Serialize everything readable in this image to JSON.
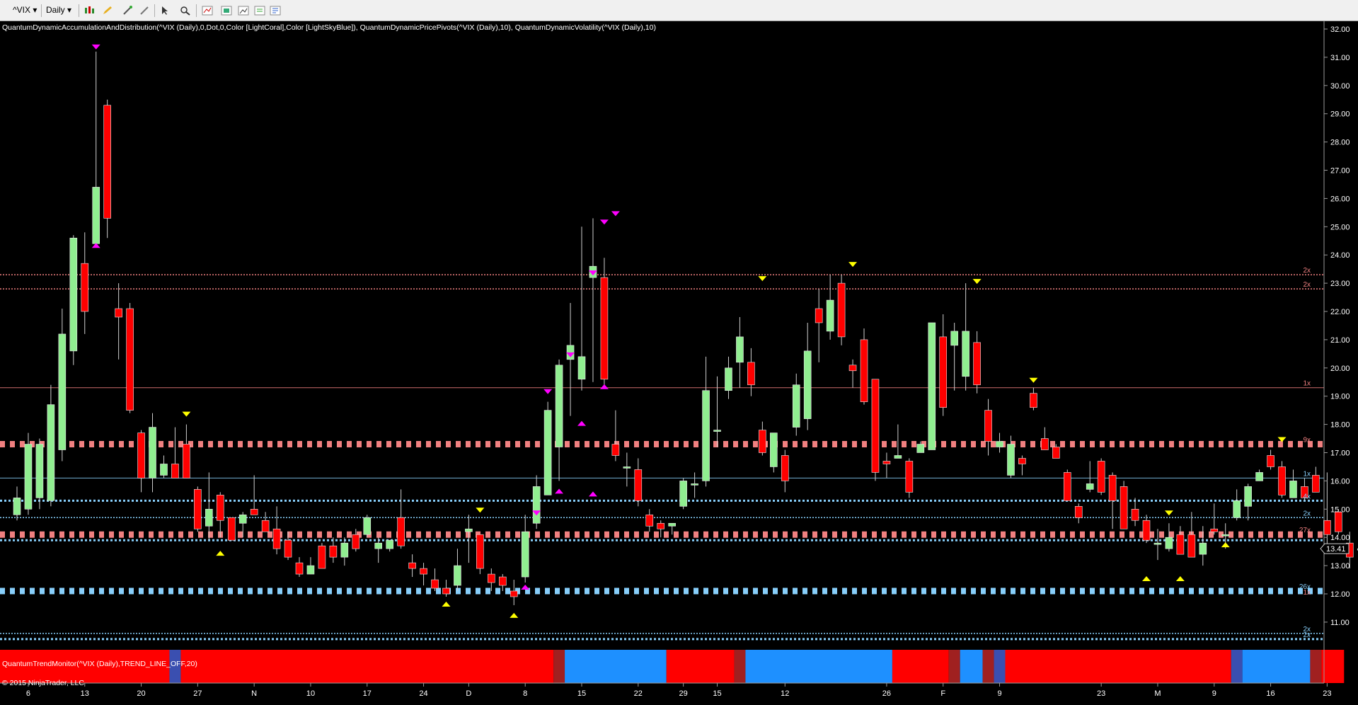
{
  "toolbar": {
    "symbol": "^VIX",
    "interval": "Daily"
  },
  "indicator_label": "QuantumDynamicAccumulationAndDistribution(^VIX (Daily),0,Dot,0,Color [LightCoral],Color [LightSkyBlue]), QuantumDynamicPricePivots(^VIX (Daily),10), QuantumDynamicVolatility(^VIX (Daily),10)",
  "trend_label": "QuantumTrendMonitor(^VIX (Daily),TREND_LINE_OFF,20)",
  "copyright": "© 2015 NinjaTrader, LLC",
  "last_price_label": "13.41",
  "colors": {
    "bull": "#90ee90",
    "bear": "#ff0000",
    "resistance": "#f08080",
    "support": "#87cefa",
    "pivot_high": "#ff00ff",
    "volatility": "#ffff00",
    "trend_bear": "#ff0000",
    "trend_bull": "#1e90ff"
  },
  "chart_data": {
    "type": "candlestick",
    "symbol": "^VIX",
    "interval": "Daily",
    "ylim": [
      10.3,
      32.3
    ],
    "y_ticks": [
      "11.00",
      "12.00",
      "13.00",
      "14.00",
      "15.00",
      "16.00",
      "17.00",
      "18.00",
      "19.00",
      "20.00",
      "21.00",
      "22.00",
      "23.00",
      "24.00",
      "25.00",
      "26.00",
      "27.00",
      "28.00",
      "29.00",
      "30.00",
      "31.00",
      "32.00"
    ],
    "x_ticks": [
      {
        "label": "6",
        "bar": 1
      },
      {
        "label": "13",
        "bar": 6
      },
      {
        "label": "20",
        "bar": 11
      },
      {
        "label": "27",
        "bar": 16
      },
      {
        "label": "N",
        "bar": 21
      },
      {
        "label": "10",
        "bar": 26
      },
      {
        "label": "17",
        "bar": 31
      },
      {
        "label": "24",
        "bar": 36
      },
      {
        "label": "D",
        "bar": 40
      },
      {
        "label": "8",
        "bar": 45
      },
      {
        "label": "15",
        "bar": 50
      },
      {
        "label": "22",
        "bar": 55
      },
      {
        "label": "29",
        "bar": 59
      },
      {
        "label": "15",
        "bar": 62
      },
      {
        "label": "12",
        "bar": 68
      },
      {
        "label": "26",
        "bar": 77
      },
      {
        "label": "F",
        "bar": 82
      },
      {
        "label": "9",
        "bar": 87
      },
      {
        "label": "23",
        "bar": 96
      },
      {
        "label": "M",
        "bar": 101
      },
      {
        "label": "9",
        "bar": 106
      },
      {
        "label": "16",
        "bar": 111
      },
      {
        "label": "23",
        "bar": 116
      }
    ],
    "candles": [
      [
        14.8,
        15.8,
        14.6,
        15.4
      ],
      [
        15.0,
        17.7,
        14.8,
        17.3
      ],
      [
        15.4,
        17.5,
        15.0,
        17.3
      ],
      [
        15.3,
        19.4,
        15.1,
        18.7
      ],
      [
        17.1,
        22.1,
        16.7,
        21.2
      ],
      [
        20.6,
        24.7,
        20.1,
        24.6
      ],
      [
        23.7,
        24.8,
        21.2,
        22.0
      ],
      [
        24.4,
        31.2,
        24.3,
        26.4
      ],
      [
        29.3,
        29.5,
        24.6,
        25.3
      ],
      [
        22.1,
        23.0,
        20.3,
        21.8
      ],
      [
        22.1,
        22.3,
        18.4,
        18.5
      ],
      [
        17.7,
        17.8,
        15.6,
        16.1
      ],
      [
        16.1,
        18.4,
        15.6,
        17.9
      ],
      [
        16.2,
        16.9,
        16.1,
        16.6
      ],
      [
        16.6,
        17.9,
        16.2,
        16.1
      ],
      [
        17.3,
        18.0,
        16.1,
        16.1
      ],
      [
        15.7,
        15.8,
        14.2,
        14.3
      ],
      [
        14.4,
        16.3,
        13.9,
        15.0
      ],
      [
        15.5,
        15.6,
        14.0,
        14.6
      ],
      [
        14.7,
        14.7,
        13.9,
        13.9
      ],
      [
        14.5,
        14.9,
        14.0,
        14.8
      ],
      [
        15.0,
        16.2,
        14.9,
        14.8
      ],
      [
        14.6,
        14.9,
        14.2,
        14.2
      ],
      [
        14.3,
        15.1,
        13.4,
        13.6
      ],
      [
        13.9,
        14.2,
        13.2,
        13.3
      ],
      [
        13.1,
        13.3,
        12.6,
        12.7
      ],
      [
        12.7,
        13.3,
        12.7,
        13.0
      ],
      [
        13.7,
        13.8,
        12.9,
        12.9
      ],
      [
        13.7,
        14.0,
        13.1,
        13.3
      ],
      [
        13.3,
        14.0,
        13.0,
        13.8
      ],
      [
        14.1,
        14.3,
        13.5,
        13.6
      ],
      [
        14.1,
        14.8,
        14.0,
        14.7
      ],
      [
        13.6,
        14.0,
        13.1,
        13.8
      ],
      [
        13.6,
        13.9,
        13.5,
        13.9
      ],
      [
        14.7,
        15.7,
        13.6,
        13.7
      ],
      [
        13.1,
        13.4,
        12.6,
        12.9
      ],
      [
        12.9,
        13.1,
        12.3,
        12.7
      ],
      [
        12.5,
        12.9,
        12.1,
        12.2
      ],
      [
        12.2,
        12.5,
        11.9,
        12.0
      ],
      [
        12.3,
        13.6,
        12.1,
        13.0
      ],
      [
        14.2,
        14.8,
        13.1,
        14.3
      ],
      [
        14.1,
        14.1,
        12.7,
        12.9
      ],
      [
        12.7,
        12.9,
        12.1,
        12.4
      ],
      [
        12.6,
        12.7,
        12.1,
        12.3
      ],
      [
        12.1,
        12.5,
        11.6,
        11.9
      ],
      [
        12.6,
        14.8,
        12.4,
        14.2
      ],
      [
        14.5,
        16.2,
        14.3,
        15.8
      ],
      [
        15.5,
        18.8,
        15.5,
        18.5
      ],
      [
        17.2,
        20.3,
        16.0,
        20.1
      ],
      [
        20.3,
        22.3,
        18.3,
        20.8
      ],
      [
        19.6,
        25.0,
        19.2,
        20.4
      ],
      [
        23.2,
        25.3,
        19.5,
        23.6
      ],
      [
        23.2,
        23.9,
        19.4,
        19.6
      ],
      [
        17.3,
        18.5,
        16.7,
        16.9
      ],
      [
        16.5,
        17.0,
        15.8,
        16.5
      ],
      [
        16.4,
        16.8,
        15.1,
        15.3
      ],
      [
        14.8,
        15.0,
        14.2,
        14.4
      ],
      [
        14.5,
        14.6,
        14.0,
        14.3
      ],
      [
        14.4,
        14.5,
        14.1,
        14.5
      ],
      [
        15.1,
        16.1,
        15.0,
        16.0
      ],
      [
        15.9,
        16.3,
        15.4,
        15.9
      ],
      [
        16.0,
        20.4,
        15.8,
        19.2
      ],
      [
        17.8,
        19.7,
        17.2,
        17.8
      ],
      [
        19.2,
        20.4,
        18.9,
        20.0
      ],
      [
        20.2,
        21.8,
        19.3,
        21.1
      ],
      [
        20.2,
        20.7,
        19.0,
        19.4
      ],
      [
        17.8,
        18.1,
        16.9,
        17.0
      ],
      [
        16.5,
        17.6,
        16.3,
        17.7
      ],
      [
        16.9,
        17.1,
        15.6,
        16.0
      ],
      [
        17.9,
        19.8,
        17.6,
        19.4
      ],
      [
        18.2,
        21.6,
        17.8,
        20.6
      ],
      [
        22.1,
        22.8,
        20.2,
        21.6
      ],
      [
        21.3,
        23.3,
        21.0,
        22.4
      ],
      [
        23.0,
        23.3,
        20.8,
        21.1
      ],
      [
        20.1,
        20.3,
        19.3,
        19.9
      ],
      [
        21.0,
        21.4,
        18.7,
        18.8
      ],
      [
        19.6,
        19.6,
        16.0,
        16.3
      ],
      [
        16.7,
        17.0,
        16.1,
        16.6
      ],
      [
        16.8,
        18.0,
        16.9,
        16.9
      ],
      [
        16.7,
        16.8,
        15.4,
        15.6
      ],
      [
        17.0,
        17.4,
        17.0,
        17.3
      ],
      [
        17.1,
        21.6,
        17.1,
        21.6
      ],
      [
        21.1,
        21.9,
        18.3,
        18.6
      ],
      [
        20.8,
        21.6,
        19.2,
        21.3
      ],
      [
        19.7,
        23.0,
        19.2,
        21.3
      ],
      [
        20.9,
        21.3,
        19.1,
        19.4
      ],
      [
        18.5,
        18.9,
        16.9,
        17.4
      ],
      [
        17.2,
        17.7,
        17.0,
        17.4
      ],
      [
        16.2,
        17.6,
        16.1,
        17.3
      ],
      [
        16.8,
        16.9,
        16.2,
        16.6
      ],
      [
        19.1,
        19.3,
        18.5,
        18.6
      ],
      [
        17.5,
        17.9,
        17.2,
        17.1
      ],
      [
        17.2,
        17.3,
        16.9,
        16.8
      ],
      [
        16.3,
        16.4,
        15.3,
        15.3
      ],
      [
        15.1,
        15.2,
        14.5,
        14.7
      ],
      [
        15.7,
        16.7,
        15.6,
        15.9
      ],
      [
        16.7,
        16.8,
        15.5,
        15.6
      ],
      [
        16.2,
        16.3,
        14.3,
        15.3
      ],
      [
        15.8,
        16.0,
        14.9,
        14.3
      ],
      [
        15.0,
        15.4,
        14.4,
        14.6
      ],
      [
        14.6,
        14.8,
        13.8,
        13.9
      ],
      [
        13.8,
        14.3,
        13.2,
        13.8
      ],
      [
        13.6,
        14.5,
        13.5,
        14.0
      ],
      [
        14.1,
        14.4,
        13.6,
        13.4
      ],
      [
        14.1,
        14.9,
        13.7,
        13.3
      ],
      [
        13.4,
        14.4,
        13.0,
        13.8
      ],
      [
        14.3,
        15.2,
        14.1,
        14.2
      ],
      [
        14.1,
        14.5,
        13.6,
        14.1
      ],
      [
        14.7,
        15.7,
        14.6,
        15.3
      ],
      [
        15.1,
        15.9,
        14.6,
        15.8
      ],
      [
        16.0,
        16.4,
        16.0,
        16.3
      ],
      [
        16.9,
        17.1,
        16.4,
        16.5
      ],
      [
        16.5,
        16.7,
        15.4,
        15.5
      ],
      [
        15.4,
        16.4,
        15.5,
        16.0
      ],
      [
        15.8,
        16.1,
        15.3,
        15.4
      ],
      [
        16.2,
        16.5,
        15.7,
        15.6
      ],
      [
        14.6,
        16.3,
        13.6,
        14.1
      ],
      [
        14.9,
        15.0,
        14.1,
        14.2
      ],
      [
        13.8,
        14.2,
        12.9,
        13.3
      ],
      [
        13.6,
        13.8,
        13.0,
        13.6
      ]
    ],
    "pivots_high": [
      {
        "bar": 7,
        "value": 31.3,
        "type": "major"
      },
      {
        "bar": 15,
        "value": 18.3,
        "type": "minor"
      },
      {
        "bar": 41,
        "value": 14.9,
        "type": "minor"
      },
      {
        "bar": 46,
        "value": 14.8,
        "type": "major"
      },
      {
        "bar": 47,
        "value": 19.1,
        "type": "major"
      },
      {
        "bar": 49,
        "value": 20.4,
        "type": "major"
      },
      {
        "bar": 51,
        "value": 23.3,
        "type": "major"
      },
      {
        "bar": 52,
        "value": 25.1,
        "type": "major"
      },
      {
        "bar": 53,
        "value": 25.4,
        "type": "major"
      },
      {
        "bar": 66,
        "value": 23.1,
        "type": "minor"
      },
      {
        "bar": 74,
        "value": 23.6,
        "type": "minor"
      },
      {
        "bar": 85,
        "value": 23.0,
        "type": "minor"
      },
      {
        "bar": 90,
        "value": 19.5,
        "type": "minor"
      },
      {
        "bar": 102,
        "value": 14.8,
        "type": "minor"
      },
      {
        "bar": 112,
        "value": 17.4,
        "type": "minor"
      }
    ],
    "pivots_low": [
      {
        "bar": 7,
        "value": 24.4,
        "type": "major"
      },
      {
        "bar": 18,
        "value": 13.5,
        "type": "minor"
      },
      {
        "bar": 38,
        "value": 11.7,
        "type": "minor"
      },
      {
        "bar": 44,
        "value": 11.3,
        "type": "minor"
      },
      {
        "bar": 45,
        "value": 12.3,
        "type": "major"
      },
      {
        "bar": 48,
        "value": 15.7,
        "type": "major"
      },
      {
        "bar": 50,
        "value": 18.1,
        "type": "major"
      },
      {
        "bar": 51,
        "value": 15.6,
        "type": "major"
      },
      {
        "bar": 52,
        "value": 19.4,
        "type": "major"
      },
      {
        "bar": 100,
        "value": 12.6,
        "type": "minor"
      },
      {
        "bar": 103,
        "value": 12.6,
        "type": "minor"
      },
      {
        "bar": 107,
        "value": 13.8,
        "type": "minor"
      }
    ],
    "levels": [
      {
        "value": 23.3,
        "kind": "thin",
        "color": "#f08080",
        "label": "2x"
      },
      {
        "value": 22.8,
        "kind": "thin",
        "color": "#f08080",
        "label": "2x"
      },
      {
        "value": 19.3,
        "kind": "solid",
        "color": "#f08080",
        "label": "1x"
      },
      {
        "value": 17.3,
        "kind": "heavy",
        "color": "#f08080",
        "label": "9x"
      },
      {
        "value": 16.1,
        "kind": "solid",
        "color": "#87cefa",
        "label": "1x"
      },
      {
        "value": 15.3,
        "kind": "dotted",
        "color": "#87cefa",
        "label": "4x"
      },
      {
        "value": 14.7,
        "kind": "thin",
        "color": "#87cefa",
        "label": "2x"
      },
      {
        "value": 14.1,
        "kind": "heavy",
        "color": "#f08080",
        "label": "27x"
      },
      {
        "value": 13.9,
        "kind": "dotted",
        "color": "#87cefa",
        "label": ""
      },
      {
        "value": 12.1,
        "kind": "heavy",
        "color": "#87cefa",
        "label": "26x"
      },
      {
        "value": 11.9,
        "kind": "none",
        "color": "#f08080",
        "label": "1x"
      },
      {
        "value": 10.6,
        "kind": "thin",
        "color": "#87cefa",
        "label": "2x"
      },
      {
        "value": 10.4,
        "kind": "dotted",
        "color": "#87cefa",
        "label": "2x"
      }
    ],
    "trend_segments": [
      {
        "from": 0,
        "to": 13,
        "state": "bear"
      },
      {
        "from": 14,
        "to": 14,
        "state": "neutral_bull"
      },
      {
        "from": 15,
        "to": 47,
        "state": "bear"
      },
      {
        "from": 48,
        "to": 48,
        "state": "neutral_bear"
      },
      {
        "from": 49,
        "to": 57,
        "state": "bull"
      },
      {
        "from": 58,
        "to": 63,
        "state": "bear"
      },
      {
        "from": 64,
        "to": 64,
        "state": "neutral_bear"
      },
      {
        "from": 65,
        "to": 77,
        "state": "bull"
      },
      {
        "from": 78,
        "to": 82,
        "state": "bear"
      },
      {
        "from": 83,
        "to": 83,
        "state": "neutral_bear"
      },
      {
        "from": 84,
        "to": 85,
        "state": "bull"
      },
      {
        "from": 86,
        "to": 86,
        "state": "neutral_bear"
      },
      {
        "from": 87,
        "to": 87,
        "state": "neutral_bull"
      },
      {
        "from": 88,
        "to": 107,
        "state": "bear"
      },
      {
        "from": 108,
        "to": 108,
        "state": "neutral_bull"
      },
      {
        "from": 109,
        "to": 114,
        "state": "bull"
      },
      {
        "from": 115,
        "to": 115,
        "state": "neutral_bear"
      },
      {
        "from": 116,
        "to": 117,
        "state": "bear"
      }
    ]
  }
}
